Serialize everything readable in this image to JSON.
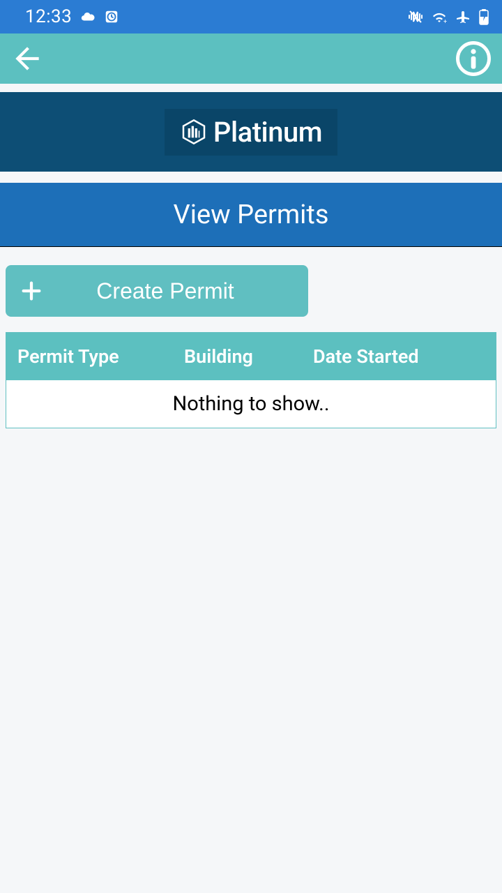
{
  "status": {
    "time": "12:33"
  },
  "brand": {
    "name": "Platinum"
  },
  "page": {
    "title": "View Permits"
  },
  "actions": {
    "create_label": "Create Permit"
  },
  "table": {
    "columns": [
      "Permit Type",
      "Building",
      "Date Started"
    ],
    "empty_message": "Nothing to show.."
  }
}
